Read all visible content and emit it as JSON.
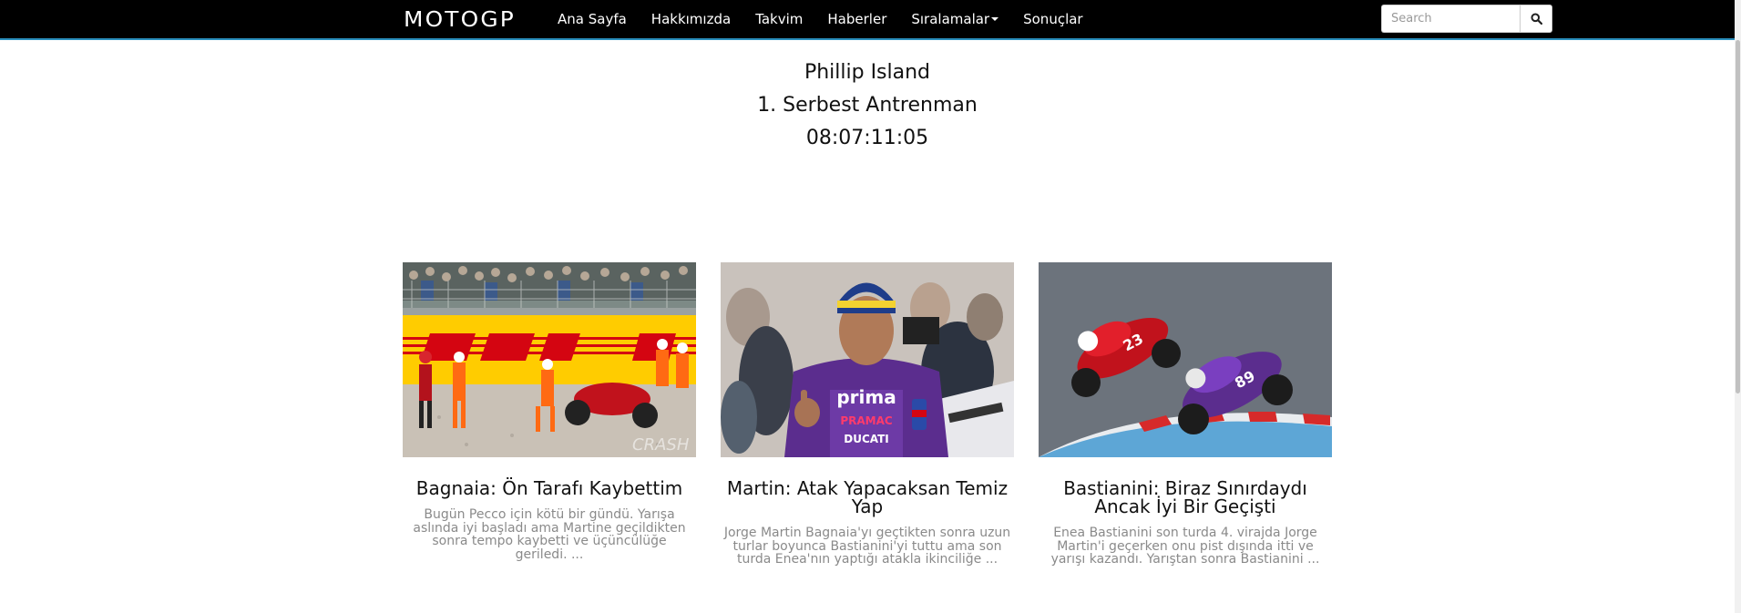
{
  "navbar": {
    "brand": "MOTOGP",
    "links": [
      "Ana Sayfa",
      "Hakkımızda",
      "Takvim",
      "Haberler",
      "Sıralamalar",
      "Sonuçlar"
    ],
    "search_placeholder": "Search",
    "search_icon": "search-icon"
  },
  "hero": {
    "location": "Phillip Island",
    "session": "1. Serbest Antrenman",
    "countdown": "08:07:11:05"
  },
  "cards": [
    {
      "title": "Bagnaia: Ön Tarafı Kaybettim",
      "excerpt": "Bugün Pecco için kötü bir gündü. Yarışa aslında iyi başladı ama Martine geçildikten sonra tempo kaybetti ve üçüncülüğe geriledi. ...",
      "image_watermark": "CRASH"
    },
    {
      "title": "Martin: Atak Yapacaksan Temiz Yap",
      "excerpt": "Jorge Martin Bagnaia'yı geçtikten sonra uzun turlar boyunca Bastianini'yi tuttu ama son turda Enea'nın yaptığı atakla ikinciliğe ...",
      "image_text": [
        "prima",
        "PRAMAC",
        "DUCATI"
      ]
    },
    {
      "title": "Bastianini: Biraz Sınırdaydı Ancak İyi Bir Geçişti",
      "excerpt": "Enea Bastianini son turda 4. virajda Jorge Martin'i geçerken onu pist dışında itti ve yarışı kazandı. Yarıştan sonra Bastianini ..."
    }
  ],
  "colors": {
    "navbar_bg": "#000000",
    "navbar_border": "#2a8fbd",
    "text": "#111111",
    "excerpt": "#8a8a8a",
    "dhl_yellow": "#ffcc00",
    "dhl_red": "#d40511",
    "pramac_purple": "#5b2d8e"
  }
}
